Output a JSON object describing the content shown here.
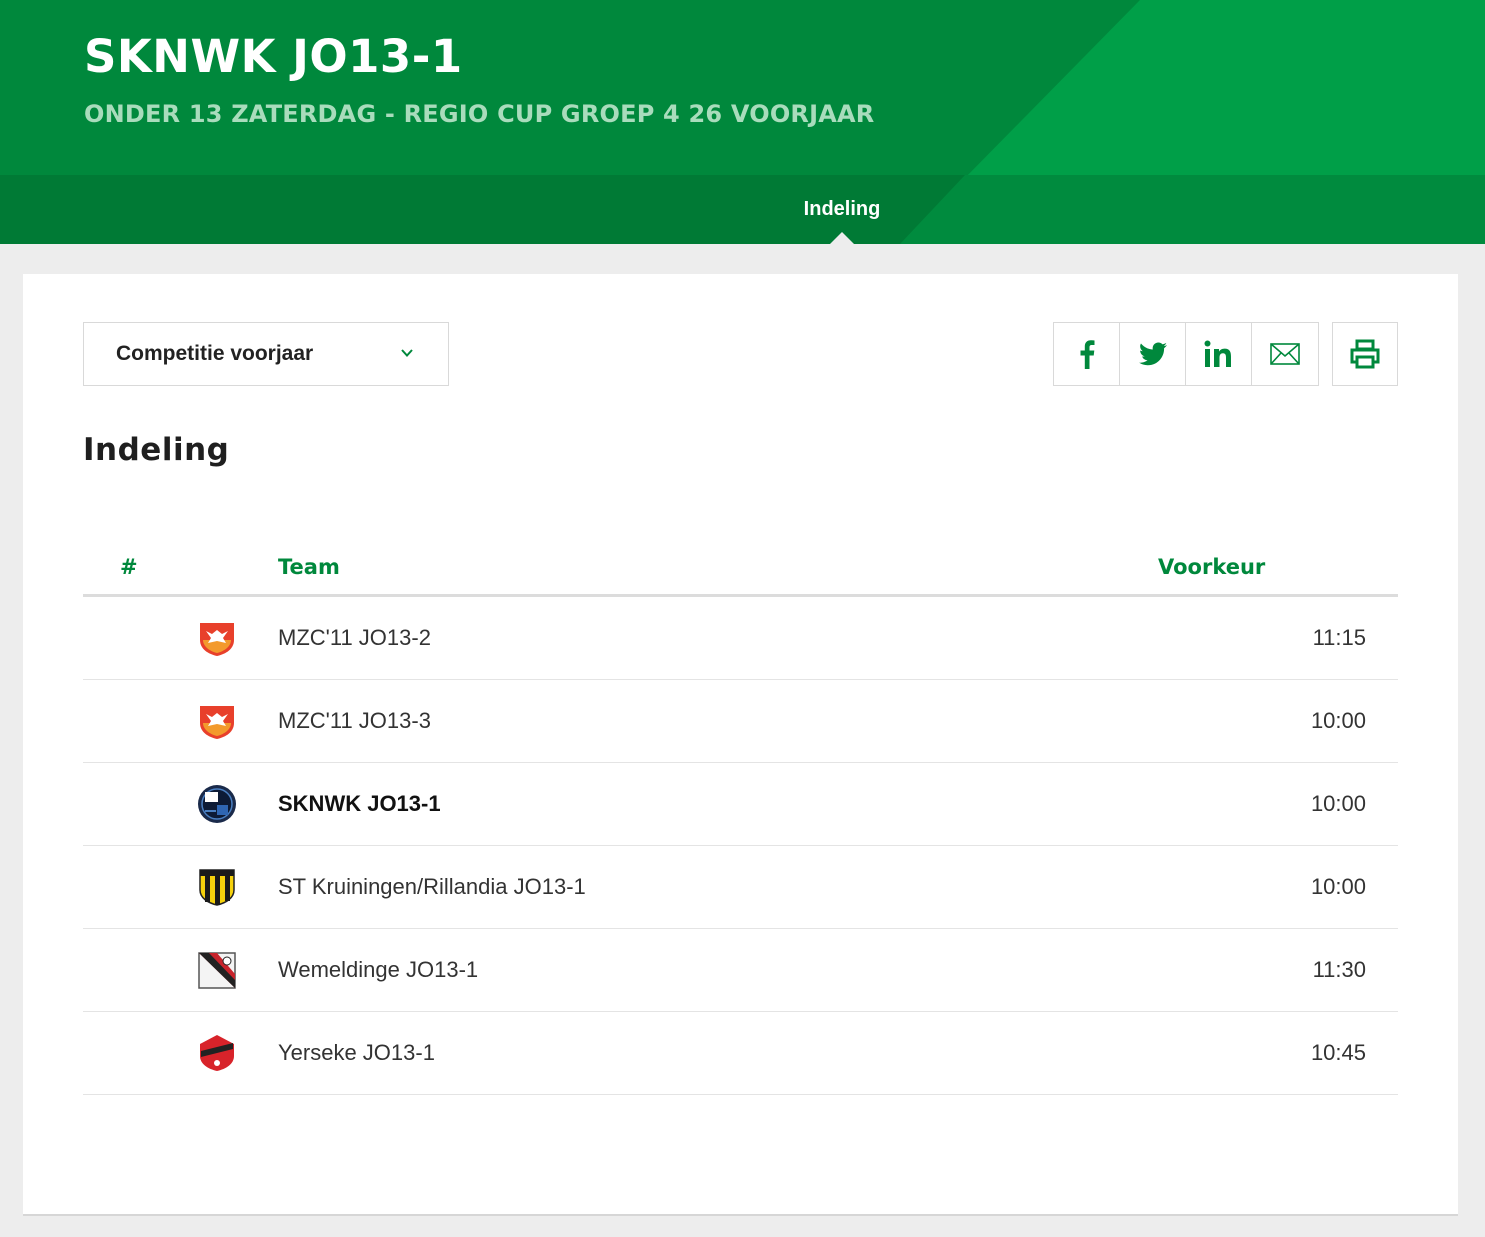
{
  "header": {
    "title": "SKNWK JO13-1",
    "subtitle": "ONDER 13 ZATERDAG - REGIO CUP GROEP 4 26 VOORJAAR",
    "tabs": [
      {
        "label": "Indeling",
        "active": true
      }
    ]
  },
  "controls": {
    "competition_select": {
      "value": "Competitie voorjaar",
      "icon": "chevron-down-icon"
    },
    "share": [
      {
        "icon": "facebook-icon"
      },
      {
        "icon": "twitter-icon"
      },
      {
        "icon": "linkedin-icon"
      },
      {
        "icon": "mail-icon"
      }
    ],
    "print": {
      "icon": "print-icon"
    }
  },
  "section": {
    "title": "Indeling"
  },
  "table": {
    "headers": {
      "num": "#",
      "team": "Team",
      "preference": "Voorkeur"
    },
    "rows": [
      {
        "team": "MZC'11 JO13-2",
        "preference": "11:15",
        "logo": "mzc11-logo"
      },
      {
        "team": "MZC'11 JO13-3",
        "preference": "10:00",
        "logo": "mzc11-logo"
      },
      {
        "team": "SKNWK JO13-1",
        "preference": "10:00",
        "logo": "sknwk-logo",
        "own": true
      },
      {
        "team": "ST Kruiningen/Rillandia JO13-1",
        "preference": "10:00",
        "logo": "kruiningen-logo"
      },
      {
        "team": "Wemeldinge JO13-1",
        "preference": "11:30",
        "logo": "wemeldinge-logo"
      },
      {
        "team": "Yerseke JO13-1",
        "preference": "10:45",
        "logo": "yerseke-logo"
      }
    ]
  },
  "colors": {
    "brand_green": "#00883c",
    "dark_green": "#007a35",
    "light_green": "#009f48"
  }
}
